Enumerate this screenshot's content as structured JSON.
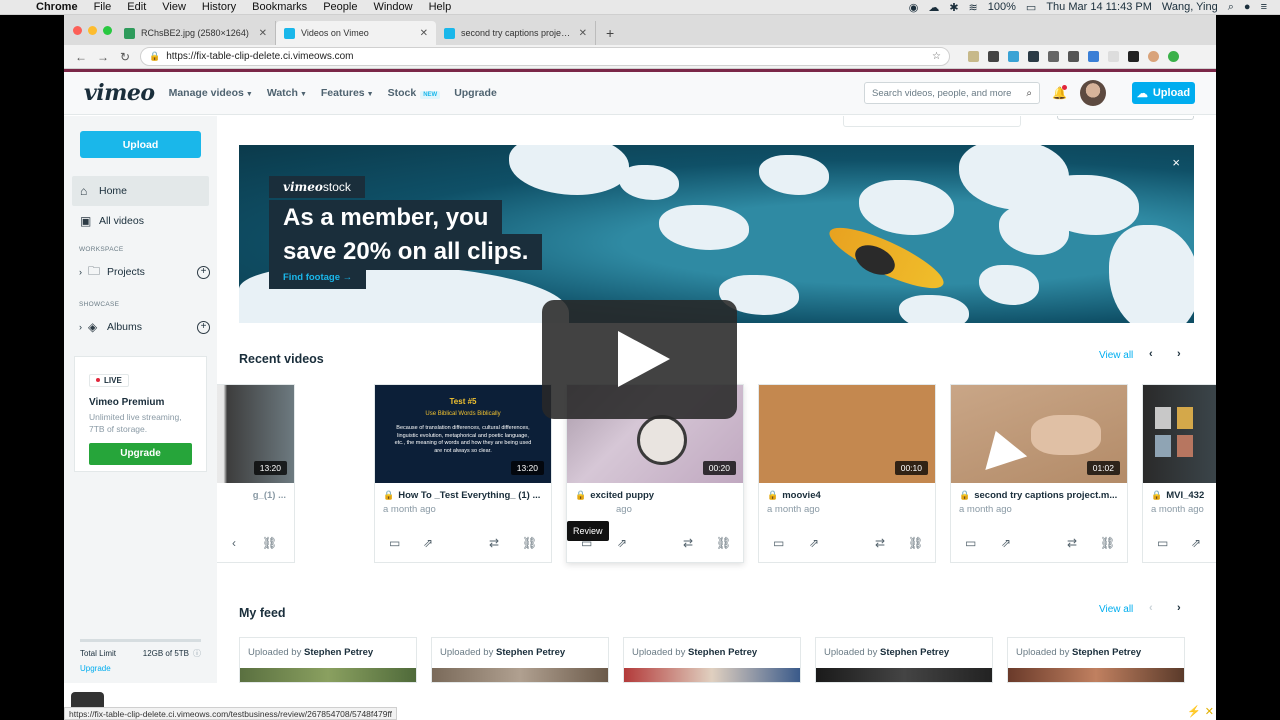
{
  "menubar": {
    "apple": "",
    "items": [
      "Chrome",
      "File",
      "Edit",
      "View",
      "History",
      "Bookmarks",
      "People",
      "Window",
      "Help"
    ],
    "battery": "100%",
    "datetime": "Thu Mar 14  11:43 PM",
    "user": "Wang, Ying"
  },
  "browser": {
    "tabs": [
      {
        "title": "RChsBE2.jpg (2580×1264)",
        "favicon_color": "#2e9b5b"
      },
      {
        "title": "Videos on Vimeo",
        "favicon_color": "#1ab7ea"
      },
      {
        "title": "second try captions project.mp4",
        "favicon_color": "#1ab7ea"
      }
    ],
    "url": "https://fix-table-clip-delete.ci.vimeows.com",
    "status_url": "https://fix-table-clip-delete.ci.vimeows.com/testbusiness/review/267854708/5748f479ff"
  },
  "header": {
    "logo": "vimeo",
    "nav": [
      "Manage videos",
      "Watch",
      "Features",
      "Stock",
      "Upgrade"
    ],
    "stock_badge": "NEW",
    "search_placeholder": "Search videos, people, and more",
    "upload": "Upload"
  },
  "sidebar": {
    "upload": "Upload",
    "home": "Home",
    "all_videos": "All videos",
    "workspace_label": "WORKSPACE",
    "projects": "Projects",
    "showcase_label": "SHOWCASE",
    "albums": "Albums",
    "premium": {
      "live": "LIVE",
      "title": "Vimeo Premium",
      "desc1": "Unlimited live streaming,",
      "desc2": "7TB of storage.",
      "button": "Upgrade"
    },
    "storage": {
      "label": "Total Limit",
      "value": "12GB of 5TB",
      "upgrade": "Upgrade"
    }
  },
  "banner": {
    "brand_vimeo": "vimeo",
    "brand_stock": "stock",
    "headline1": "As a member, you",
    "headline2": "save 20% on all clips.",
    "link": "Find footage →",
    "close": "×"
  },
  "recent": {
    "title": "Recent videos",
    "view_all": "View all",
    "cards": [
      {
        "title": "g_(1) ...",
        "meta": "",
        "duration": "13:20"
      },
      {
        "title": "How To _Test Everything_ (1) ...",
        "meta": "a month ago",
        "duration": "13:20"
      },
      {
        "title": "excited puppy",
        "meta": "ago",
        "duration": "00:20"
      },
      {
        "title": "moovie4",
        "meta": "a month ago",
        "duration": "00:10"
      },
      {
        "title": "second try captions project.m...",
        "meta": "a month ago",
        "duration": "01:02"
      },
      {
        "title": "MVI_432",
        "meta": "a month ago",
        "duration": ""
      }
    ],
    "tooltip": "Review",
    "test_slide": {
      "title": "Test #5",
      "subtitle": "Use Biblical Words Biblically",
      "body": "Because of translation differences, cultural differences, linguistic evolution, metaphorical and poetic language, etc., the meaning of words and how they are being used are not always so clear."
    }
  },
  "feed": {
    "title": "My feed",
    "view_all": "View all",
    "uploaded_by": "Uploaded by",
    "cards": [
      "Stephen Petrey",
      "Stephen Petrey",
      "Stephen Petrey",
      "Stephen Petrey",
      "Stephen Petrey"
    ]
  }
}
